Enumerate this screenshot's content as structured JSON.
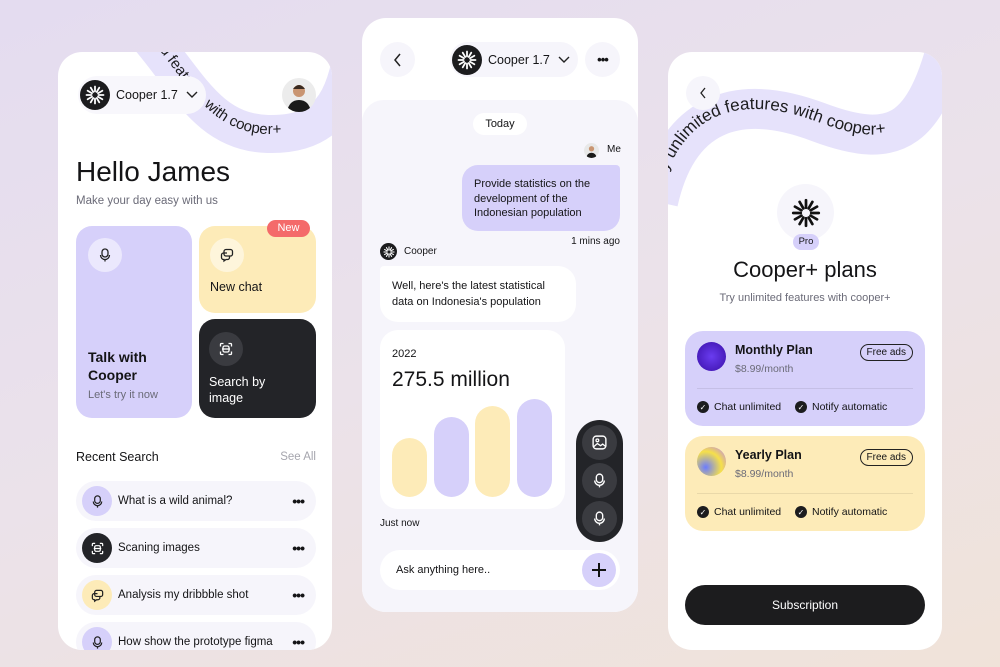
{
  "banner_text": "Try unlimited features with cooper+",
  "colors": {
    "lavender": "#d6d0fa",
    "yellow": "#fdebb8",
    "dark": "#232428",
    "badge_red": "#f46a6a",
    "surface": "#f6f5fb"
  },
  "home": {
    "model_selector": "Cooper 1.7",
    "greeting": "Hello James",
    "subtitle": "Make your day easy with us",
    "cards": {
      "talk": {
        "title": "Talk with Cooper",
        "subtitle": "Let's try it now",
        "icon": "microphone-icon"
      },
      "new_chat": {
        "title": "New chat",
        "badge": "New",
        "icon": "chat-bubbles-icon"
      },
      "search_image": {
        "title": "Search by image",
        "icon": "scan-icon"
      }
    },
    "recent_title": "Recent Search",
    "see_all": "See All",
    "recent": [
      {
        "label": "What is a wild animal?",
        "icon": "microphone-icon"
      },
      {
        "label": "Scaning images",
        "icon": "scan-icon"
      },
      {
        "label": "Analysis my dribbble shot",
        "icon": "chat-bubbles-icon"
      },
      {
        "label": "How show the prototype figma",
        "icon": "microphone-icon"
      }
    ]
  },
  "chat": {
    "model_selector": "Cooper 1.7",
    "date_pill": "Today",
    "me_label": "Me",
    "user_message": "Provide statistics on the development of the Indonesian population",
    "user_time": "1 mins ago",
    "bot_name": "Cooper",
    "bot_message": "Well, here's the latest statistical data on Indonesia's population",
    "stat_card": {
      "year": "2022",
      "value": "275.5 million",
      "bar_levels": [
        0.6,
        0.82,
        0.93,
        1.0
      ]
    },
    "bot_time": "Just now",
    "input_placeholder": "Ask anything here..",
    "fab_actions": [
      "image-icon",
      "microphone-icon",
      "microphone-icon"
    ]
  },
  "plans": {
    "badge": "Pro",
    "title": "Cooper+ plans",
    "subtitle": "Try unlimited features with cooper+",
    "items": [
      {
        "name": "Monthly Plan",
        "price": "$8.99/month",
        "tag": "Free ads",
        "features": [
          "Chat unlimited",
          "Notify automatic"
        ]
      },
      {
        "name": "Yearly Plan",
        "price": "$8.99/month",
        "tag": "Free ads",
        "features": [
          "Chat unlimited",
          "Notify automatic"
        ]
      }
    ],
    "cta": "Subscription"
  }
}
